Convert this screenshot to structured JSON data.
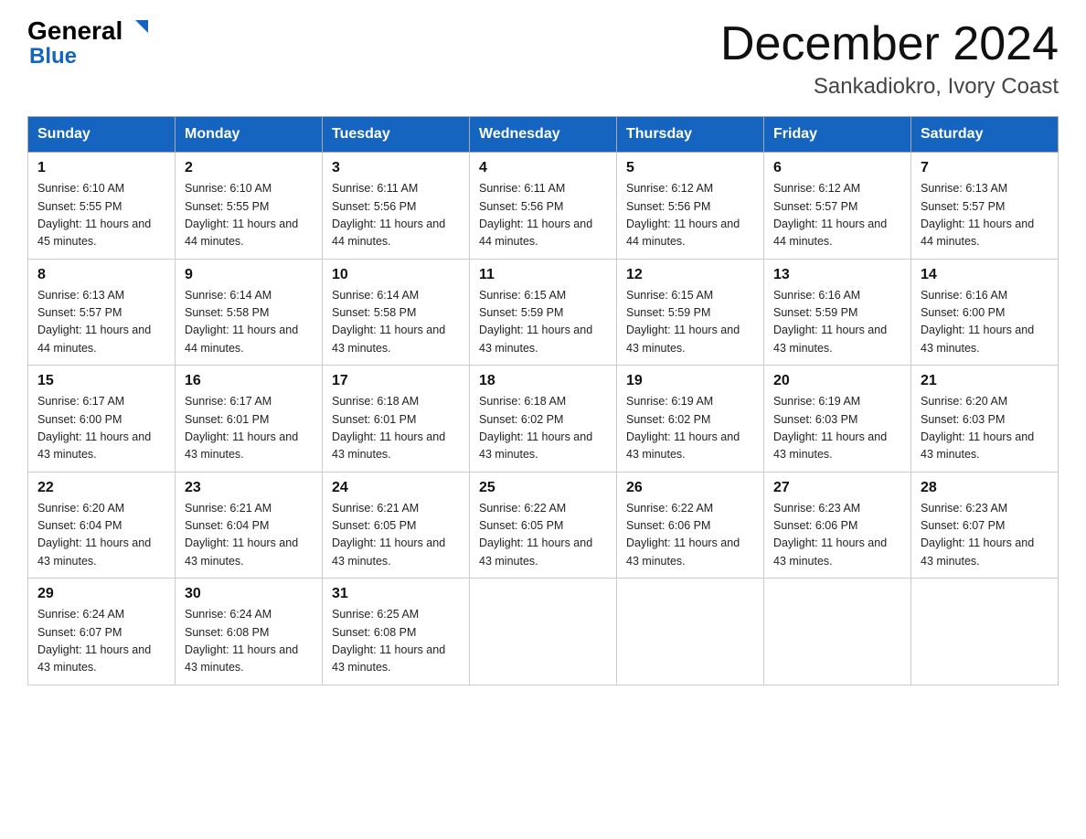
{
  "logo": {
    "general": "General",
    "blue": "Blue",
    "triangle": "▶"
  },
  "title": {
    "month": "December 2024",
    "location": "Sankadiokro, Ivory Coast"
  },
  "days_header": [
    "Sunday",
    "Monday",
    "Tuesday",
    "Wednesday",
    "Thursday",
    "Friday",
    "Saturday"
  ],
  "weeks": [
    [
      {
        "day": "1",
        "sunrise": "6:10 AM",
        "sunset": "5:55 PM",
        "daylight": "11 hours and 45 minutes."
      },
      {
        "day": "2",
        "sunrise": "6:10 AM",
        "sunset": "5:55 PM",
        "daylight": "11 hours and 44 minutes."
      },
      {
        "day": "3",
        "sunrise": "6:11 AM",
        "sunset": "5:56 PM",
        "daylight": "11 hours and 44 minutes."
      },
      {
        "day": "4",
        "sunrise": "6:11 AM",
        "sunset": "5:56 PM",
        "daylight": "11 hours and 44 minutes."
      },
      {
        "day": "5",
        "sunrise": "6:12 AM",
        "sunset": "5:56 PM",
        "daylight": "11 hours and 44 minutes."
      },
      {
        "day": "6",
        "sunrise": "6:12 AM",
        "sunset": "5:57 PM",
        "daylight": "11 hours and 44 minutes."
      },
      {
        "day": "7",
        "sunrise": "6:13 AM",
        "sunset": "5:57 PM",
        "daylight": "11 hours and 44 minutes."
      }
    ],
    [
      {
        "day": "8",
        "sunrise": "6:13 AM",
        "sunset": "5:57 PM",
        "daylight": "11 hours and 44 minutes."
      },
      {
        "day": "9",
        "sunrise": "6:14 AM",
        "sunset": "5:58 PM",
        "daylight": "11 hours and 44 minutes."
      },
      {
        "day": "10",
        "sunrise": "6:14 AM",
        "sunset": "5:58 PM",
        "daylight": "11 hours and 43 minutes."
      },
      {
        "day": "11",
        "sunrise": "6:15 AM",
        "sunset": "5:59 PM",
        "daylight": "11 hours and 43 minutes."
      },
      {
        "day": "12",
        "sunrise": "6:15 AM",
        "sunset": "5:59 PM",
        "daylight": "11 hours and 43 minutes."
      },
      {
        "day": "13",
        "sunrise": "6:16 AM",
        "sunset": "5:59 PM",
        "daylight": "11 hours and 43 minutes."
      },
      {
        "day": "14",
        "sunrise": "6:16 AM",
        "sunset": "6:00 PM",
        "daylight": "11 hours and 43 minutes."
      }
    ],
    [
      {
        "day": "15",
        "sunrise": "6:17 AM",
        "sunset": "6:00 PM",
        "daylight": "11 hours and 43 minutes."
      },
      {
        "day": "16",
        "sunrise": "6:17 AM",
        "sunset": "6:01 PM",
        "daylight": "11 hours and 43 minutes."
      },
      {
        "day": "17",
        "sunrise": "6:18 AM",
        "sunset": "6:01 PM",
        "daylight": "11 hours and 43 minutes."
      },
      {
        "day": "18",
        "sunrise": "6:18 AM",
        "sunset": "6:02 PM",
        "daylight": "11 hours and 43 minutes."
      },
      {
        "day": "19",
        "sunrise": "6:19 AM",
        "sunset": "6:02 PM",
        "daylight": "11 hours and 43 minutes."
      },
      {
        "day": "20",
        "sunrise": "6:19 AM",
        "sunset": "6:03 PM",
        "daylight": "11 hours and 43 minutes."
      },
      {
        "day": "21",
        "sunrise": "6:20 AM",
        "sunset": "6:03 PM",
        "daylight": "11 hours and 43 minutes."
      }
    ],
    [
      {
        "day": "22",
        "sunrise": "6:20 AM",
        "sunset": "6:04 PM",
        "daylight": "11 hours and 43 minutes."
      },
      {
        "day": "23",
        "sunrise": "6:21 AM",
        "sunset": "6:04 PM",
        "daylight": "11 hours and 43 minutes."
      },
      {
        "day": "24",
        "sunrise": "6:21 AM",
        "sunset": "6:05 PM",
        "daylight": "11 hours and 43 minutes."
      },
      {
        "day": "25",
        "sunrise": "6:22 AM",
        "sunset": "6:05 PM",
        "daylight": "11 hours and 43 minutes."
      },
      {
        "day": "26",
        "sunrise": "6:22 AM",
        "sunset": "6:06 PM",
        "daylight": "11 hours and 43 minutes."
      },
      {
        "day": "27",
        "sunrise": "6:23 AM",
        "sunset": "6:06 PM",
        "daylight": "11 hours and 43 minutes."
      },
      {
        "day": "28",
        "sunrise": "6:23 AM",
        "sunset": "6:07 PM",
        "daylight": "11 hours and 43 minutes."
      }
    ],
    [
      {
        "day": "29",
        "sunrise": "6:24 AM",
        "sunset": "6:07 PM",
        "daylight": "11 hours and 43 minutes."
      },
      {
        "day": "30",
        "sunrise": "6:24 AM",
        "sunset": "6:08 PM",
        "daylight": "11 hours and 43 minutes."
      },
      {
        "day": "31",
        "sunrise": "6:25 AM",
        "sunset": "6:08 PM",
        "daylight": "11 hours and 43 minutes."
      },
      null,
      null,
      null,
      null
    ]
  ]
}
